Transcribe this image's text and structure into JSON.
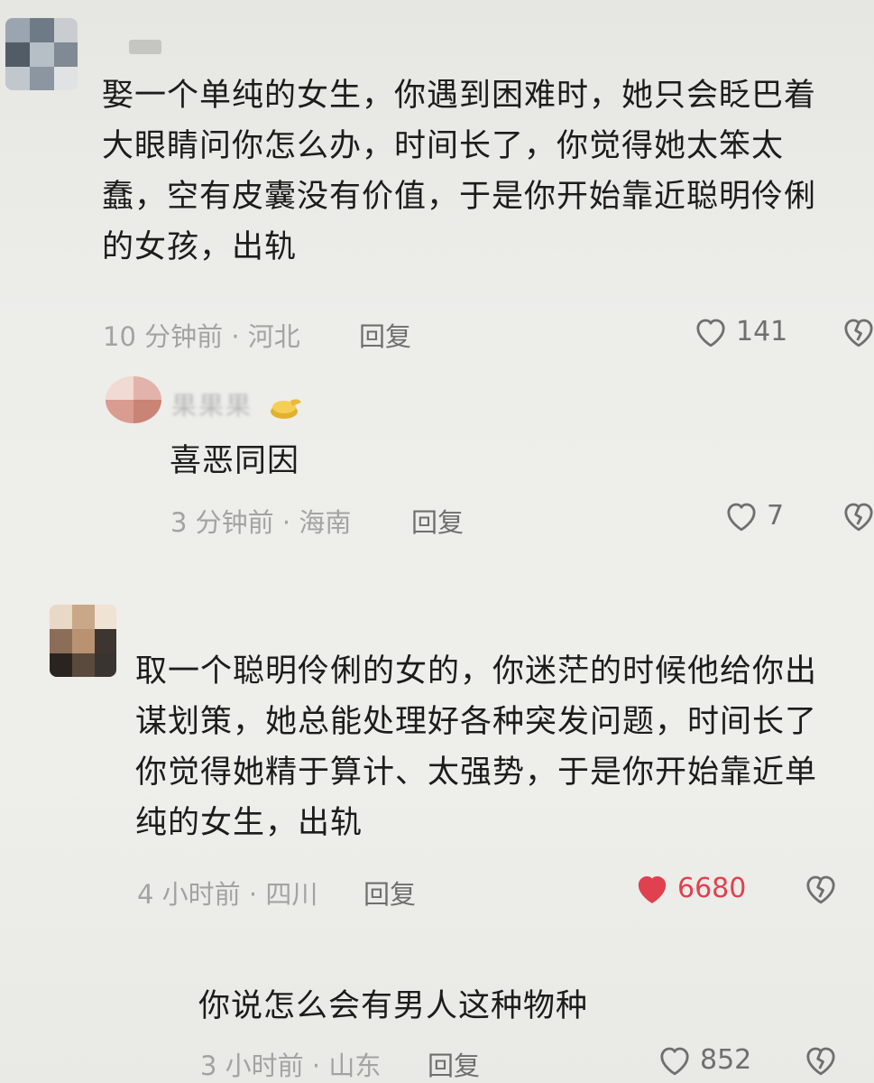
{
  "comments": [
    {
      "text": "娶一个单纯的女生，你遇到困难时，她只会眨巴着\n大眼睛问你怎么办，时间长了，你觉得她太笨太\n蠢，空有皮囊没有价值，于是你开始靠近聪明伶俐\n的女孩，出轨",
      "meta": "10 分钟前 · 河北",
      "reply_label": "回复",
      "likes": "141",
      "liked": false,
      "replies": [
        {
          "username": "果果果",
          "text": "喜恶同因",
          "meta": "3 分钟前 · 海南",
          "reply_label": "回复",
          "likes": "7",
          "liked": false
        }
      ]
    },
    {
      "text": "取一个聪明伶俐的女的，你迷茫的时候他给你出\n谋划策，她总能处理好各种突发问题，时间长了\n你觉得她精于算计、太强势，于是你开始靠近单\n纯的女生，出轨",
      "meta": "4 小时前 · 四川",
      "reply_label": "回复",
      "likes": "6680",
      "liked": true,
      "replies": [
        {
          "text": "你说怎么会有男人这种物种",
          "meta": "3 小时前 · 山东",
          "reply_label": "回复",
          "likes": "852",
          "liked": false
        }
      ]
    }
  ],
  "colors": {
    "liked": "#e0414f",
    "meta": "#a3a3a3",
    "reply": "#6e6e6e",
    "count": "#6f6f6f"
  },
  "icons": {
    "like": "heart-outline-icon",
    "liked": "heart-filled-icon",
    "dislike": "broken-heart-icon"
  }
}
